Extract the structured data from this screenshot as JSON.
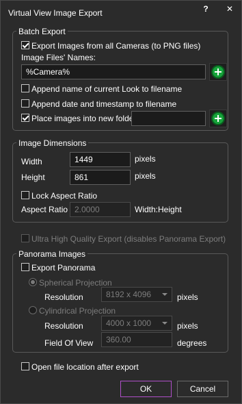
{
  "window": {
    "title": "Virtual View Image Export",
    "help": "?",
    "close": "✕"
  },
  "batch": {
    "legend": "Batch Export",
    "export_all_label": "Export Images from all Cameras (to PNG files)",
    "export_all_checked": true,
    "names_label": "Image Files' Names:",
    "names_value": "%Camera%",
    "append_look_label": "Append name of current Look to filename",
    "append_look_checked": false,
    "append_date_label": "Append date and timestamp to filename",
    "append_date_checked": false,
    "new_folder_label": "Place images into new folder",
    "new_folder_checked": true,
    "new_folder_value": ""
  },
  "dims": {
    "legend": "Image Dimensions",
    "width_label": "Width",
    "width_value": "1449",
    "width_unit": "pixels",
    "height_label": "Height",
    "height_value": "861",
    "height_unit": "pixels",
    "lock_label": "Lock Aspect Ratio",
    "lock_checked": false,
    "aspect_label": "Aspect Ratio",
    "aspect_value": "2.0000",
    "aspect_unit": "Width:Height"
  },
  "uhq": {
    "label": "Ultra High Quality Export (disables Panorama Export)",
    "checked": false
  },
  "pano": {
    "legend": "Panorama Images",
    "export_label": "Export Panorama",
    "export_checked": false,
    "spherical_label": "Spherical Projection",
    "spherical_selected": true,
    "sph_res_label": "Resolution",
    "sph_res_value": "8192 x 4096",
    "sph_res_unit": "pixels",
    "cylindrical_label": "Cylindrical Projection",
    "cyl_res_label": "Resolution",
    "cyl_res_value": "4000 x 1000",
    "cyl_res_unit": "pixels",
    "fov_label": "Field Of View",
    "fov_value": "360.00",
    "fov_unit": "degrees"
  },
  "open_location": {
    "label": "Open file location after export",
    "checked": false
  },
  "buttons": {
    "ok": "OK",
    "cancel": "Cancel"
  }
}
